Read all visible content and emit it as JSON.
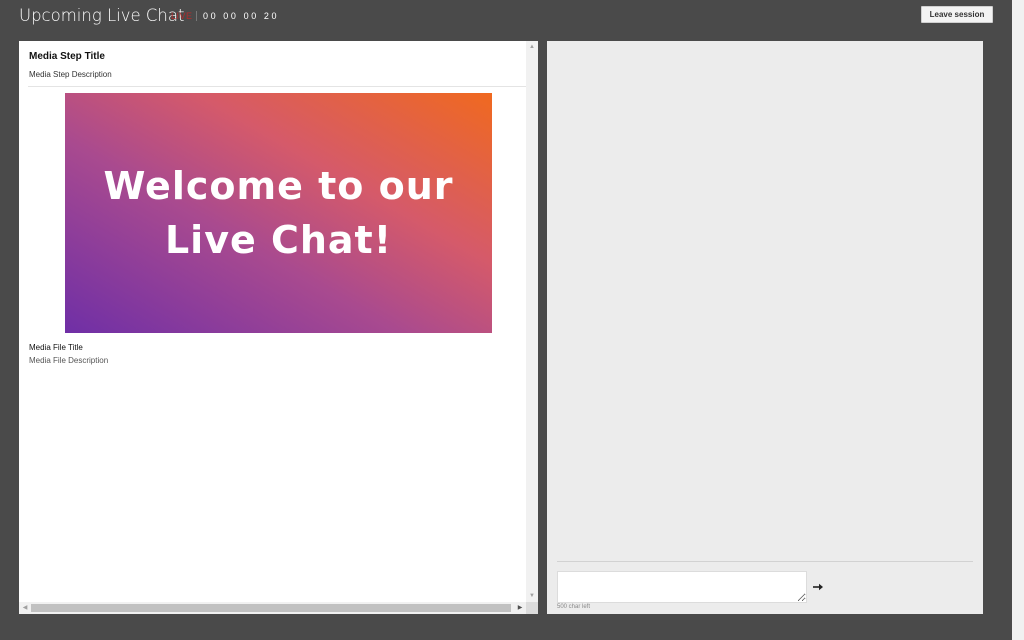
{
  "header": {
    "title": "Upcoming Live Chat",
    "live_label": "LIVE",
    "timer": "00 00 00 20",
    "leave_label": "Leave session"
  },
  "media_step": {
    "title": "Media Step Title",
    "description": "Media Step Description",
    "image_text": [
      "Welcome to our",
      "Live Chat!"
    ],
    "file_title": "Media File Title",
    "file_description": "Media File Description"
  },
  "chat": {
    "input_value": "",
    "char_left": "500 char left",
    "send_icon": "arrow-right-icon"
  },
  "colors": {
    "background": "#4a4a4a",
    "live": "#b52a2a",
    "chat_panel": "#ececec",
    "gradient_start": "#6f2fa6",
    "gradient_end": "#f0691f"
  }
}
